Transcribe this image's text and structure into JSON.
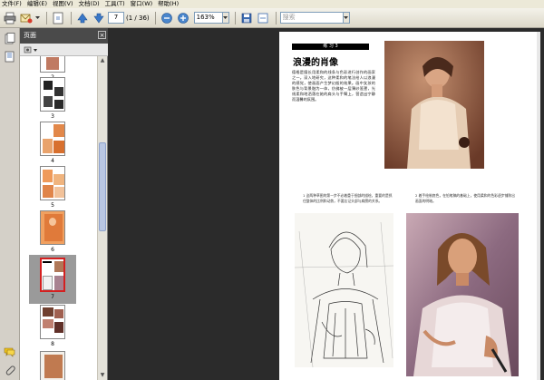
{
  "menu": {
    "items": [
      "文件(F)",
      "编辑(E)",
      "视图(V)",
      "文档(D)",
      "工具(T)",
      "窗口(W)",
      "帮助(H)"
    ]
  },
  "toolbar": {
    "page_number": "7",
    "page_count": "(1 / 36)",
    "zoom": "163%",
    "search_placeholder": "搜索"
  },
  "panel": {
    "title": "页面",
    "close_label": "×",
    "thumbnails": [
      {
        "label": "2"
      },
      {
        "label": "3"
      },
      {
        "label": "4"
      },
      {
        "label": "5"
      },
      {
        "label": "6"
      },
      {
        "label": "7"
      },
      {
        "label": "8"
      }
    ],
    "selected_page": "7"
  },
  "document": {
    "page_tag": "练 习 3",
    "title": "浪漫的肖像",
    "body": "德格是擅长用柔和的线条与色彩进行创作的画家之一。深入地研究，这种柔和的笔法给人以浪漫的感觉，使画面产生梦幻般的效果。画中女孩的肤色与背景融为一体，仿佛被一层薄纱笼罩，光线柔和地洒落在她的肩头与手臂上，营造出宁静而温馨的氛围。",
    "caption_1": "1 这两种草图的第一步不必着重于细部的描绘，重要的是抓住整体的比例和动势，不要忘记头部与肩膀的关系。",
    "caption_2": "2 着手绘制底色，在铅笔稿的基础上，使用柔和的色彩逐步铺陈出画面的明暗。"
  },
  "colors": {
    "accent_red": "#d42020",
    "panel_header": "#4a4a4a",
    "doc_background": "#2b2b2b"
  }
}
